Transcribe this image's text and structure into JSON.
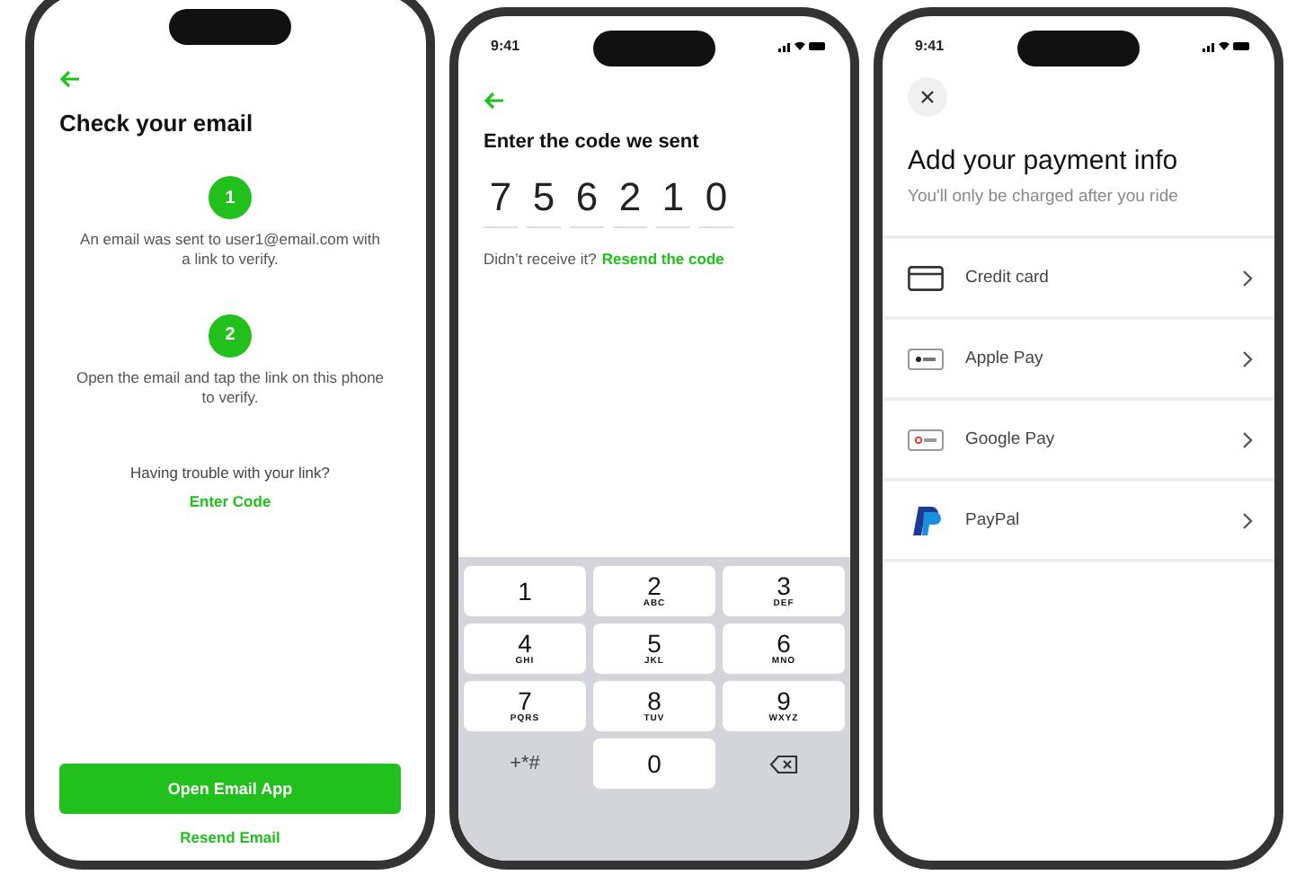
{
  "check_email_screen": {
    "title": "Check your email",
    "steps": [
      {
        "number": "1",
        "text": "An email was sent to user1@email.com with a link to verify."
      },
      {
        "number": "2",
        "text": "Open the email and tap the link on this phone to verify."
      }
    ],
    "trouble_text": "Having trouble with your link?",
    "enter_code_link": "Enter Code",
    "primary_button": "Open Email App",
    "resend_link": "Resend Email"
  },
  "code_screen": {
    "status_time": "9:41",
    "title": "Enter the code we sent",
    "code_digits": [
      "7",
      "5",
      "6",
      "2",
      "1",
      "0"
    ],
    "resend_prompt": "Didn’t receive it?",
    "resend_link": "Resend the code",
    "keypad": [
      {
        "kind": "digit",
        "digit": "1"
      },
      {
        "kind": "digit",
        "digit": "2",
        "letters": "ABC"
      },
      {
        "kind": "digit",
        "digit": "3",
        "letters": "DEF"
      },
      {
        "kind": "digit",
        "digit": "4",
        "letters": "GHI"
      },
      {
        "kind": "digit",
        "digit": "5",
        "letters": "JKL"
      },
      {
        "kind": "digit",
        "digit": "6",
        "letters": "MNO"
      },
      {
        "kind": "digit",
        "digit": "7",
        "letters": "PQRS"
      },
      {
        "kind": "digit",
        "digit": "8",
        "letters": "TUV"
      },
      {
        "kind": "digit",
        "digit": "9",
        "letters": "WXYZ"
      },
      {
        "kind": "symbols",
        "label": "+*#"
      },
      {
        "kind": "digit",
        "digit": "0"
      },
      {
        "kind": "delete"
      }
    ]
  },
  "payment_screen": {
    "status_time": "9:41",
    "title": "Add your payment info",
    "subtitle": "You'll only be charged after you ride",
    "methods": [
      {
        "kind": "card",
        "label": "Credit card"
      },
      {
        "kind": "applepay",
        "label": "Apple Pay"
      },
      {
        "kind": "googlepay",
        "label": "Google Pay"
      },
      {
        "kind": "paypal",
        "label": "PayPal"
      }
    ]
  }
}
